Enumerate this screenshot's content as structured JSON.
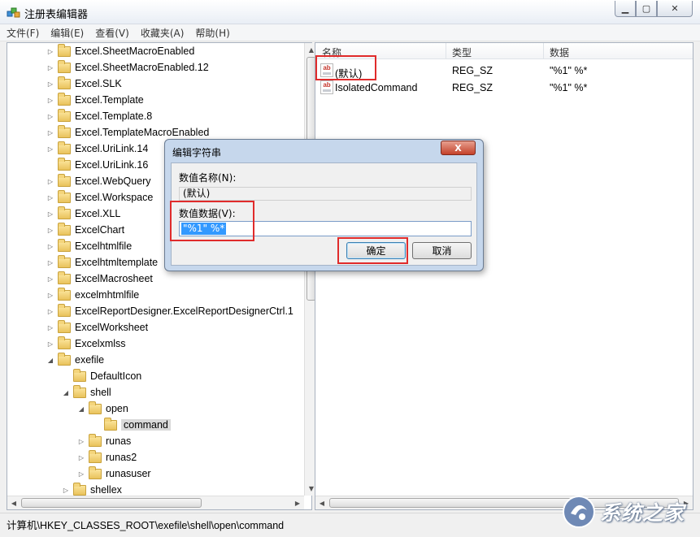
{
  "window": {
    "title": "注册表编辑器"
  },
  "menu": [
    "文件(F)",
    "编辑(E)",
    "查看(V)",
    "收藏夹(A)",
    "帮助(H)"
  ],
  "tree": {
    "items": [
      {
        "label": "Excel.SheetMacroEnabled",
        "level": 0,
        "expander": "closed"
      },
      {
        "label": "Excel.SheetMacroEnabled.12",
        "level": 0,
        "expander": "closed"
      },
      {
        "label": "Excel.SLK",
        "level": 0,
        "expander": "closed"
      },
      {
        "label": "Excel.Template",
        "level": 0,
        "expander": "closed"
      },
      {
        "label": "Excel.Template.8",
        "level": 0,
        "expander": "closed"
      },
      {
        "label": "Excel.TemplateMacroEnabled",
        "level": 0,
        "expander": "closed"
      },
      {
        "label": "Excel.UriLink.14",
        "level": 0,
        "expander": "closed"
      },
      {
        "label": "Excel.UriLink.16",
        "level": 0,
        "expander": "none"
      },
      {
        "label": "Excel.WebQuery",
        "level": 0,
        "expander": "closed"
      },
      {
        "label": "Excel.Workspace",
        "level": 0,
        "expander": "closed"
      },
      {
        "label": "Excel.XLL",
        "level": 0,
        "expander": "closed"
      },
      {
        "label": "ExcelChart",
        "level": 0,
        "expander": "closed"
      },
      {
        "label": "Excelhtmlfile",
        "level": 0,
        "expander": "closed"
      },
      {
        "label": "Excelhtmltemplate",
        "level": 0,
        "expander": "closed"
      },
      {
        "label": "ExcelMacrosheet",
        "level": 0,
        "expander": "closed"
      },
      {
        "label": "excelmhtmlfile",
        "level": 0,
        "expander": "closed"
      },
      {
        "label": "ExcelReportDesigner.ExcelReportDesignerCtrl.1",
        "level": 0,
        "expander": "closed"
      },
      {
        "label": "ExcelWorksheet",
        "level": 0,
        "expander": "closed"
      },
      {
        "label": "Excelxmlss",
        "level": 0,
        "expander": "closed"
      },
      {
        "label": "exefile",
        "level": 0,
        "expander": "open"
      },
      {
        "label": "DefaultIcon",
        "level": 1,
        "expander": "none"
      },
      {
        "label": "shell",
        "level": 1,
        "expander": "open"
      },
      {
        "label": "open",
        "level": 2,
        "expander": "open"
      },
      {
        "label": "command",
        "level": 3,
        "expander": "none",
        "selected": true
      },
      {
        "label": "runas",
        "level": 2,
        "expander": "closed"
      },
      {
        "label": "runas2",
        "level": 2,
        "expander": "closed"
      },
      {
        "label": "runasuser",
        "level": 2,
        "expander": "closed"
      },
      {
        "label": "shellex",
        "level": 1,
        "expander": "closed"
      }
    ]
  },
  "list": {
    "headers": {
      "name": "名称",
      "type": "类型",
      "data": "数据"
    },
    "rows": [
      {
        "icon": "string-value-icon",
        "name": "(默认)",
        "type": "REG_SZ",
        "data": "\"%1\" %*"
      },
      {
        "icon": "string-value-icon",
        "name": "IsolatedCommand",
        "type": "REG_SZ",
        "data": "\"%1\" %*"
      }
    ]
  },
  "statusbar": {
    "path": "计算机\\HKEY_CLASSES_ROOT\\exefile\\shell\\open\\command"
  },
  "dialog": {
    "title": "编辑字符串",
    "close_label": "X",
    "name_label": "数值名称(N):",
    "name_value": "(默认)",
    "data_label": "数值数据(V):",
    "data_value": "\"%1\" %*",
    "ok_label": "确定",
    "cancel_label": "取消"
  },
  "watermark": {
    "text": "系统之家"
  },
  "colors": {
    "highlight": "#e02b2b",
    "selection": "#3399ff",
    "dialog_frame": "#c6d7ec"
  }
}
